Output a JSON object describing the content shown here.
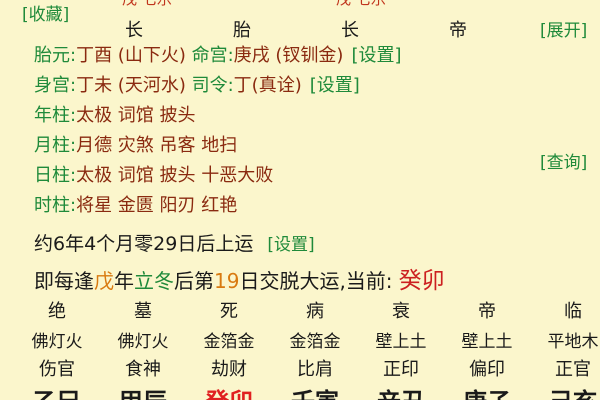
{
  "header": {
    "bookmark_label": "[收藏]",
    "expand_label": "[展开]",
    "cutoff_top_left": "戊 七乐",
    "cutoff_top_right": "戊 七乐",
    "top_stages": [
      "长",
      "胎",
      "长",
      "帝"
    ]
  },
  "info": [
    {
      "label": "胎元:",
      "value": "丁酉 (山下火)",
      "extra_label": "命宫:",
      "extra_value": "庚戌 (钗钏金)",
      "action": "[设置]"
    },
    {
      "label": "身宫:",
      "value": "丁未 (天河水)",
      "extra_label": "司令:",
      "extra_value": "丁(真诠)",
      "action": "[设置]"
    },
    {
      "label": "年柱:",
      "value": "太极 词馆 披头"
    },
    {
      "label": "月柱:",
      "value": "月德 灾煞 吊客 地扫"
    },
    {
      "label": "日柱:",
      "value": "太极 词馆 披头 十恶大败"
    },
    {
      "label": "时柱:",
      "value": "将星 金匮 阳刃 红艳"
    }
  ],
  "query_label": "[查询]",
  "start_luck": {
    "text": "约6年4个月零29日后上运",
    "action": "[设置]"
  },
  "transfer": {
    "prefix": "即每逢",
    "stem": "戊",
    "year_word": "年",
    "term": "立冬",
    "after": "后第",
    "day": "19",
    "suffix": "日交脱大运,当前:",
    "current": "癸卯"
  },
  "grid": {
    "stages": [
      "绝",
      "墓",
      "死",
      "病",
      "衰",
      "帝",
      "临"
    ],
    "nayin": [
      "佛灯火",
      "佛灯火",
      "金箔金",
      "金箔金",
      "壁上土",
      "壁上土",
      "平地木"
    ],
    "gods": [
      "伤官",
      "食神",
      "劫财",
      "比肩",
      "正印",
      "偏印",
      "正官"
    ],
    "ganzhi": [
      "乙巳",
      "甲辰",
      "癸卯",
      "壬寅",
      "辛丑",
      "庚子",
      "己亥"
    ],
    "current_index": 2
  }
}
